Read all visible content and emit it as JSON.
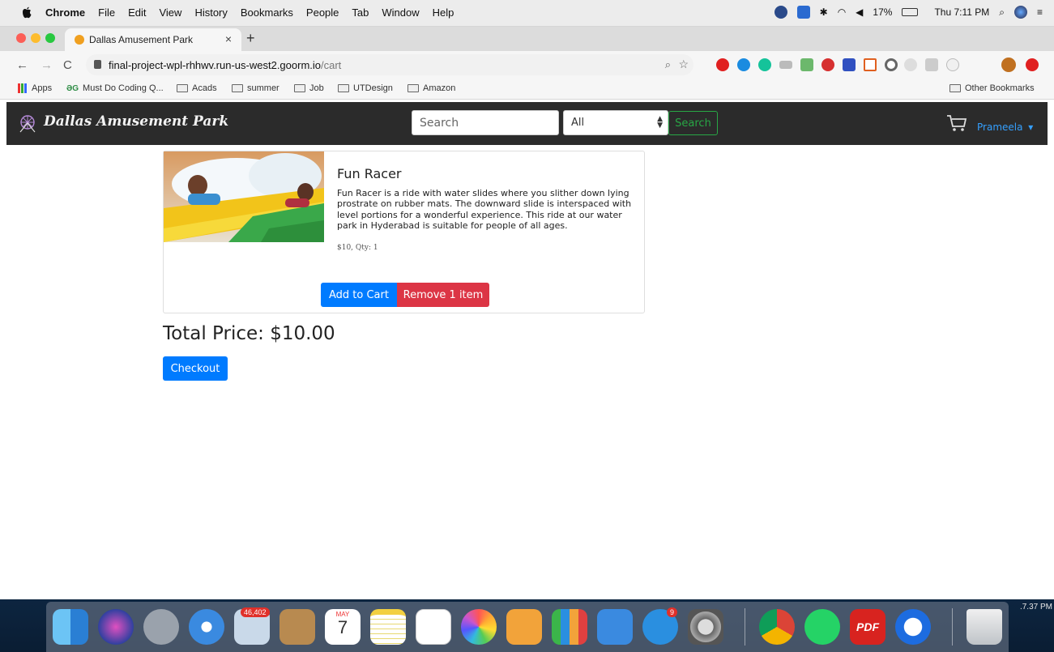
{
  "menubar": {
    "app_name": "Chrome",
    "menus": [
      "File",
      "Edit",
      "View",
      "History",
      "Bookmarks",
      "People",
      "Tab",
      "Window",
      "Help"
    ],
    "battery": "17%",
    "clock": "Thu 7:11 PM"
  },
  "browser": {
    "tab_title": "Dallas Amusement Park",
    "tab_close": "×",
    "new_tab": "+",
    "url_host": "final-project-wpl-rhhwv.run-us-west2.goorm.io",
    "url_path": "/cart",
    "back": "←",
    "forward": "→",
    "reload": "C",
    "bookmarks": [
      {
        "label": "Apps"
      },
      {
        "label": "Must Do Coding Q..."
      },
      {
        "label": "Acads"
      },
      {
        "label": "summer"
      },
      {
        "label": "Job"
      },
      {
        "label": "UTDesign"
      },
      {
        "label": "Amazon"
      }
    ],
    "other_bookmarks": "Other Bookmarks"
  },
  "site": {
    "brand": "Dallas Amusement Park",
    "search_placeholder": "Search",
    "category_selected": "All",
    "search_button": "Search",
    "user_name": "Prameela",
    "user_caret": "▾"
  },
  "cart": {
    "item": {
      "title": "Fun Racer",
      "description": "Fun Racer is a ride with water slides where you slither down lying prostrate on rubber mats. The downward slide is interspaced with level portions for a wonderful experience. This ride at our water park in Hyderabad is suitable for people of all ages.",
      "meta": "$10, Qty: 1"
    },
    "add_button": "Add to Cart",
    "remove_button": "Remove 1 item",
    "total": "Total Price: $10.00",
    "checkout_button": "Checkout"
  },
  "dock": {
    "mail_badge": "46,402",
    "calendar_month": "MAY",
    "calendar_day": "7",
    "appstore_badge": "9",
    "pdf_label": "PDF",
    "corner_time": ".7.37 PM"
  },
  "colors": {
    "navbar_bg": "#2b2b2b",
    "primary": "#007bff",
    "danger": "#dc3545",
    "success": "#28a745",
    "user_link": "#35a0ff"
  }
}
